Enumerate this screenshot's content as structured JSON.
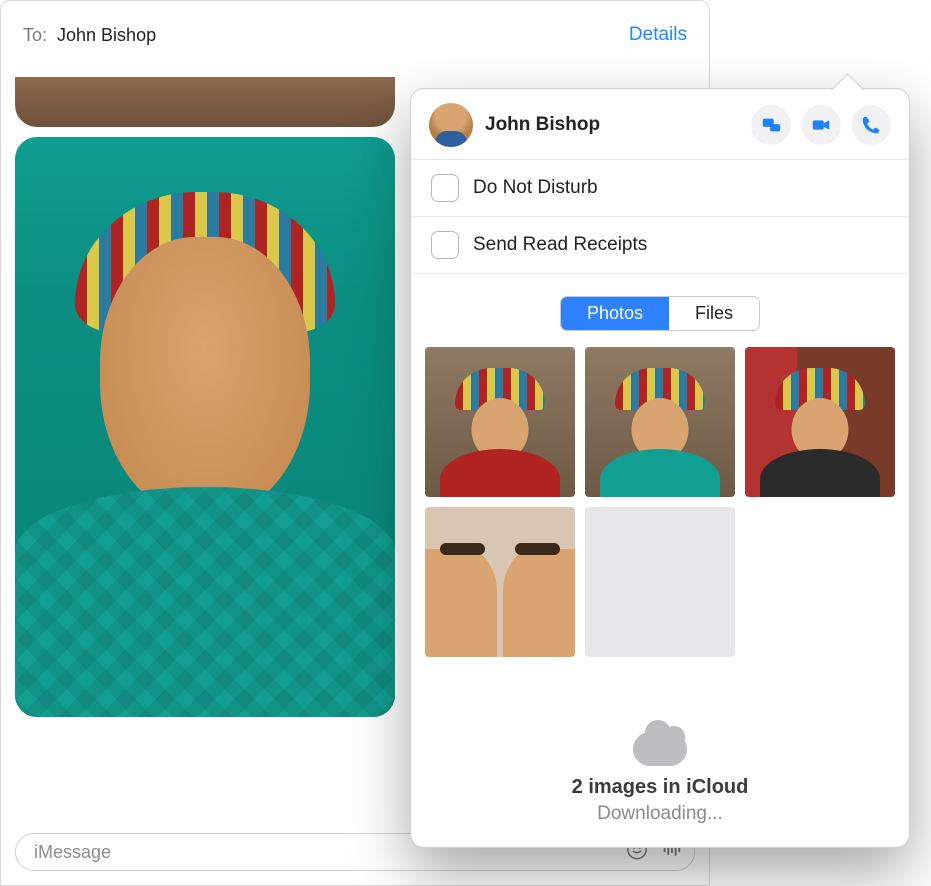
{
  "header": {
    "to_label": "To:",
    "recipient": "John Bishop",
    "details_label": "Details"
  },
  "compose": {
    "placeholder": "iMessage"
  },
  "details_panel": {
    "contact_name": "John Bishop",
    "options": {
      "dnd_label": "Do Not Disturb",
      "read_receipts_label": "Send Read Receipts"
    },
    "segments": {
      "photos": "Photos",
      "files": "Files",
      "active": "photos"
    },
    "icloud": {
      "count_text": "2 images in iCloud",
      "status_text": "Downloading..."
    }
  }
}
